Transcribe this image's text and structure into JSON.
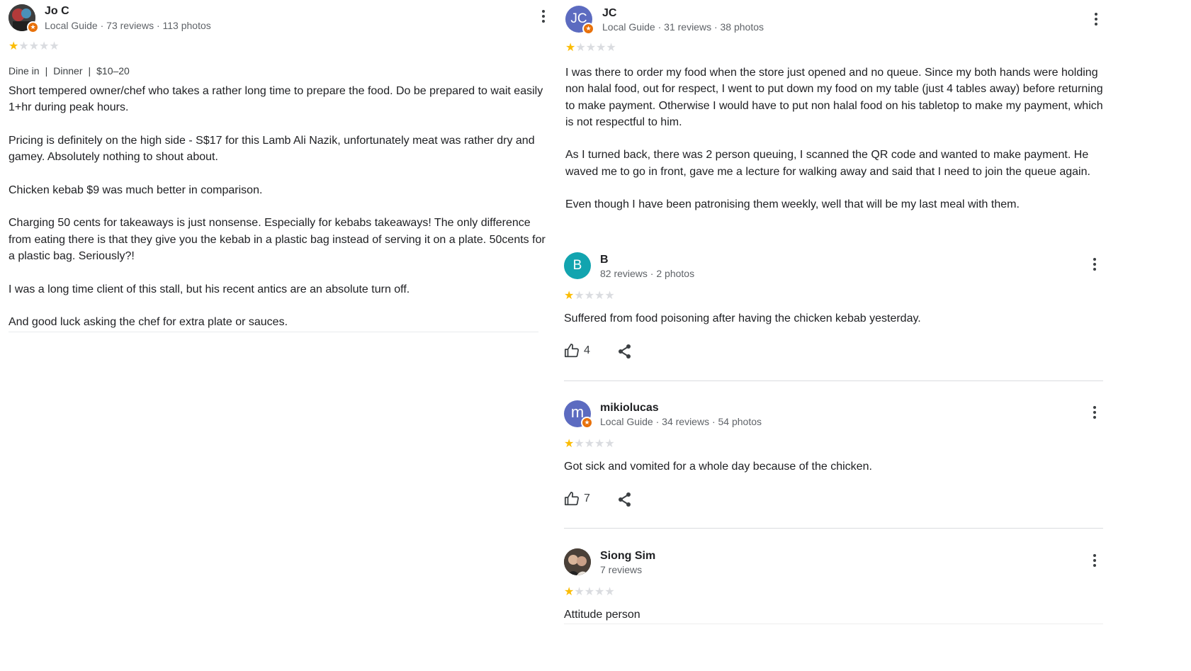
{
  "reviews": [
    {
      "name": "Jo C",
      "meta": "Local Guide · 73 reviews · 113 photos",
      "avatar_initials": "",
      "avatar_color": "#2c2c2c",
      "local_guide": true,
      "rating": 1,
      "tags": [
        "Dine in",
        "Dinner",
        "$10–20"
      ],
      "paragraphs": [
        "Short tempered owner/chef who takes a rather long time to prepare the food. Do be prepared to wait easily 1+hr during peak hours.",
        "Pricing is definitely on the high side - S$17 for this Lamb Ali Nazik, unfortunately meat was rather dry and gamey. Absolutely nothing to shout about.",
        "Chicken kebab $9 was much better in comparison.",
        "Charging 50 cents for takeaways is just nonsense. Especially for kebabs takeaways! The only difference from eating there is that they give you the kebab in a plastic bag instead of serving it on a plate. 50cents for a plastic bag. Seriously?!",
        "I was a long time client of this stall, but his recent antics are an absolute turn off.",
        "And good luck asking the chef for extra plate or sauces."
      ]
    },
    {
      "name": "JC",
      "meta": "Local Guide · 31 reviews · 38 photos",
      "avatar_initials": "JC",
      "avatar_color": "#5c6bc0",
      "local_guide": true,
      "rating": 1,
      "paragraphs": [
        "I was there to order my food when the store just opened and no queue. Since my both hands were holding non halal food, out for respect, I went to put down my food on my table (just 4 tables away) before returning to make payment. Otherwise I would have to put non halal food on his tabletop to make my payment, which is not respectful to him.",
        "As I turned back, there was 2 person queuing, I scanned the QR code and wanted to make payment. He waved me to go in front, gave me a lecture for walking away and said that I need to join the queue again.",
        "Even though I have been patronising them weekly, well that will be my last meal with them."
      ]
    },
    {
      "name": "B",
      "meta": "82 reviews · 2 photos",
      "avatar_initials": "B",
      "avatar_color": "#12a4af",
      "local_guide": false,
      "rating": 1,
      "paragraphs": [
        "Suffered from food poisoning after having the chicken kebab yesterday."
      ],
      "likes": "4"
    },
    {
      "name": "mikiolucas",
      "meta": "Local Guide · 34 reviews · 54 photos",
      "avatar_initials": "m",
      "avatar_color": "#5c6bc0",
      "local_guide": true,
      "rating": 1,
      "paragraphs": [
        "Got sick and vomited for a whole day because of the chicken."
      ],
      "likes": "7"
    },
    {
      "name": "Siong Sim",
      "meta": "7 reviews",
      "avatar_initials": "",
      "avatar_color": "#3a3a3a",
      "local_guide": false,
      "rating": 1,
      "paragraphs": [
        "Attitude person"
      ]
    }
  ],
  "colors": {
    "star_filled": "#fbbc04",
    "star_empty": "#dadce0",
    "local_guide_badge": "#e8710a"
  }
}
